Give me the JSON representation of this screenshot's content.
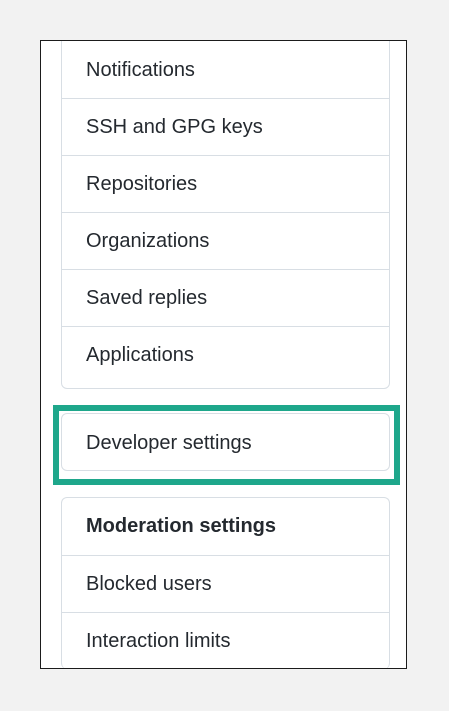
{
  "settings_menu": {
    "items": [
      {
        "label": "Notifications"
      },
      {
        "label": "SSH and GPG keys"
      },
      {
        "label": "Repositories"
      },
      {
        "label": "Organizations"
      },
      {
        "label": "Saved replies"
      },
      {
        "label": "Applications"
      }
    ]
  },
  "developer_menu": {
    "label": "Developer settings",
    "highlight_color": "#1ea78b"
  },
  "moderation_menu": {
    "heading": "Moderation settings",
    "items": [
      {
        "label": "Blocked users"
      },
      {
        "label": "Interaction limits"
      }
    ]
  },
  "colors": {
    "page_background": "#f2f2f2",
    "border": "#d8dee4",
    "text": "#24292f"
  }
}
